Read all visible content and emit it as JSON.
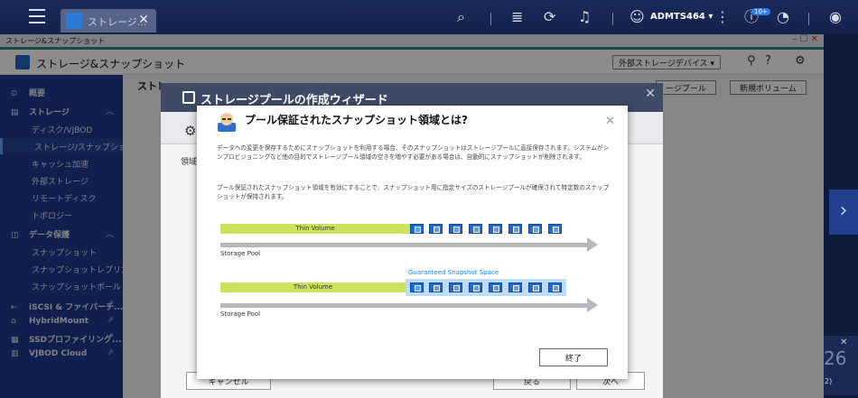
{
  "topbar": {
    "tab_label": "ストレージ...",
    "tab_close": "✕",
    "user": "ADMTS464 ▾",
    "notification_badge": "10+"
  },
  "window": {
    "title": "ストレージ&スナップショット",
    "controls": "– ☐"
  },
  "header": {
    "app_title": "ストレージ&スナップショット",
    "external_storage": "外部ストレージデバイス ▾"
  },
  "sidebar": {
    "items": [
      {
        "label": "概要",
        "type": "head",
        "icon": "⏲"
      },
      {
        "label": "ストレージ",
        "type": "head",
        "icon": "▤",
        "chevron": "︿"
      },
      {
        "label": "ディスク/VJBOD",
        "type": "sub"
      },
      {
        "label": "ストレージ/スナップショ...",
        "type": "sub",
        "active": true
      },
      {
        "label": "キャッシュ加速",
        "type": "sub"
      },
      {
        "label": "外部ストレージ",
        "type": "sub"
      },
      {
        "label": "リモートディスク",
        "type": "sub"
      },
      {
        "label": "トポロジー",
        "type": "sub"
      },
      {
        "label": "データ保護",
        "type": "head",
        "icon": "◫",
        "chevron": "︿"
      },
      {
        "label": "スナップショット",
        "type": "sub"
      },
      {
        "label": "スナップショットレプリカ",
        "type": "sub"
      },
      {
        "label": "スナップショットボールト",
        "type": "sub"
      },
      {
        "label": "iSCSI & ファイバーチ...",
        "type": "head",
        "icon": "⇠",
        "ext": "⇗"
      },
      {
        "label": "HybridMount",
        "type": "head",
        "icon": "⌂",
        "ext": "⇗"
      },
      {
        "label": "SSDプロファイリング...",
        "type": "head",
        "icon": "▦",
        "ext": "⇗"
      },
      {
        "label": "VJBOD Cloud",
        "type": "head",
        "icon": "▥",
        "ext": "⇗"
      }
    ]
  },
  "content": {
    "heading_fragment": "ストレ",
    "btn_storage_pool": "ージプール",
    "btn_new_volume": "新規ボリューム"
  },
  "wizard": {
    "title": "ストレージプールの作成ウィザード",
    "close": "✕",
    "label": "領域",
    "cancel": "キャンセル",
    "back": "戻る",
    "next": "次へ"
  },
  "dialog": {
    "title": "プール保証されたスナップショット領域とは?",
    "close": "✕",
    "para1": "データへの変更を保存するためにスナップショットを利用する場合、そのスナップショットはストレージプールに直接保存されます。システムがシンプロビジョニングなど他の目的でストレージプール領域の空きを増やす必要がある場合は、自動的にスナップショットが削除されます。",
    "para2": "プール保証されたスナップショット領域を有効にすることで、スナップショット用に指定サイズのストレージプールが確保されて特定数のスナップショットが保持されます。",
    "thin_volume": "Thin Volume",
    "storage_pool": "Storage Pool",
    "guaranteed": "Guaranteed Snapshot Space",
    "finish": "終了"
  },
  "rightstrip": {
    "number": "26",
    "small": "2)",
    "close": "✕",
    "arrow": "›"
  }
}
